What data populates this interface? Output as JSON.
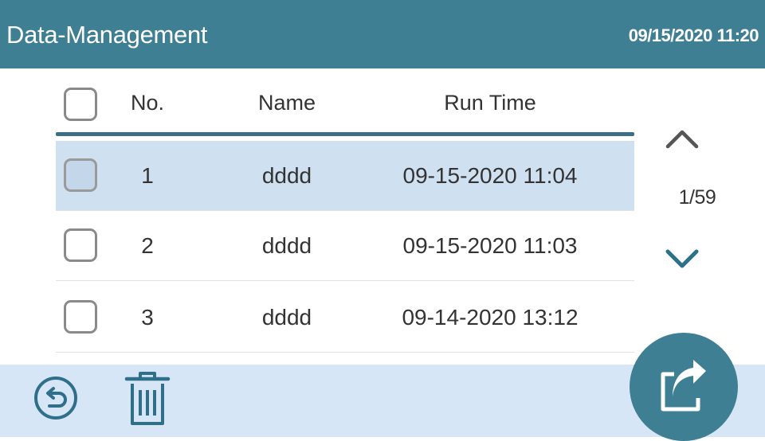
{
  "header": {
    "title": "Data-Management",
    "datetime": "09/15/2020 11:20"
  },
  "table": {
    "columns": [
      "No.",
      "Name",
      "Run Time"
    ],
    "rows": [
      {
        "no": "1",
        "name": "dddd",
        "run_time": "09-15-2020 11:04",
        "selected": true
      },
      {
        "no": "2",
        "name": "dddd",
        "run_time": "09-15-2020 11:03",
        "selected": false
      },
      {
        "no": "3",
        "name": "dddd",
        "run_time": "09-14-2020 13:12",
        "selected": false
      }
    ]
  },
  "pager": {
    "indicator": "1/59",
    "up_icon": "chevron-up-icon",
    "down_icon": "chevron-down-icon"
  },
  "footer": {
    "back_icon": "back-arrow-icon",
    "delete_icon": "trash-icon",
    "export_icon": "export-share-icon"
  },
  "colors": {
    "header_bg": "#3f7f93",
    "selected_row": "#cfe0f1",
    "footer_bg": "#d6e6f6",
    "accent": "#3f7f93"
  }
}
